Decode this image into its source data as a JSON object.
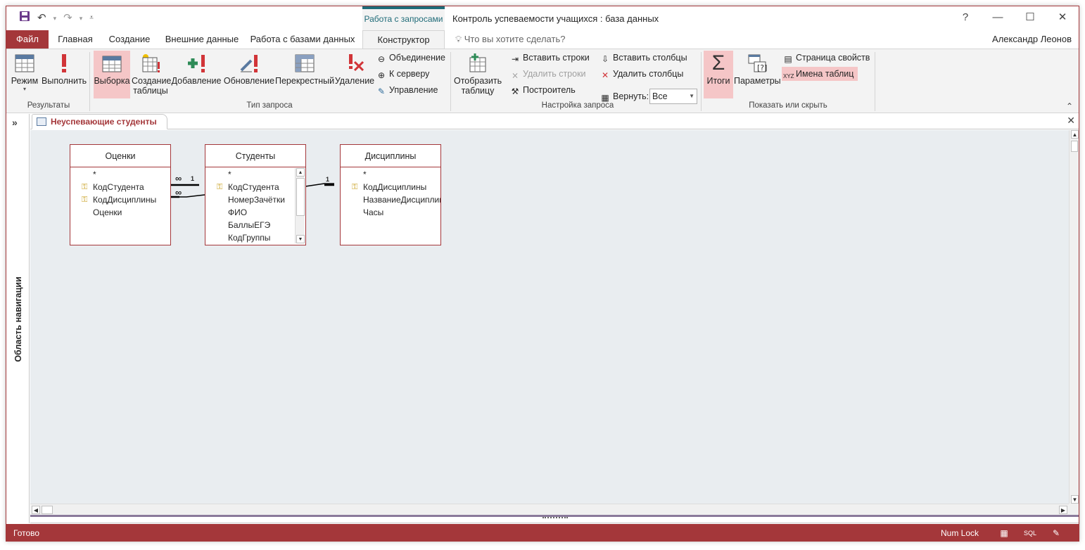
{
  "qat": {
    "save_icon": "save-icon",
    "undo_icon": "undo-icon",
    "redo_icon": "redo-icon",
    "customize_icon": "customize-qat-icon"
  },
  "context_tab": "Работа с запросами",
  "window_title": "Контроль успеваемости учащихся : база данных",
  "window_controls": {
    "help": "?",
    "minimize": "—",
    "maximize": "☐",
    "close": "✕"
  },
  "tabs": [
    "Файл",
    "Главная",
    "Создание",
    "Внешние данные",
    "Работа с базами данных",
    "Конструктор"
  ],
  "tell_me": "Что вы хотите сделать?",
  "user_name": "Александр Леонов",
  "ribbon": {
    "results": {
      "mode": "Режим",
      "run": "Выполнить",
      "label": "Результаты"
    },
    "query_type": {
      "select": "Выборка",
      "make_table_1": "Создание",
      "make_table_2": "таблицы",
      "append": "Добавление",
      "update": "Обновление",
      "crosstab": "Перекрестный",
      "delete": "Удаление",
      "union": "Объединение",
      "pass_through": "К серверу",
      "data_definition": "Управление",
      "label": "Тип запроса"
    },
    "query_setup": {
      "show_table_1": "Отобразить",
      "show_table_2": "таблицу",
      "insert_rows": "Вставить строки",
      "delete_rows": "Удалить строки",
      "builder": "Построитель",
      "insert_columns": "Вставить столбцы",
      "delete_columns": "Удалить столбцы",
      "return_label": "Вернуть:",
      "return_value": "Все",
      "label": "Настройка запроса"
    },
    "show_hide": {
      "totals": "Итоги",
      "parameters": "Параметры",
      "property_sheet": "Страница свойств",
      "table_names": "Имена таблиц",
      "label": "Показать или скрыть"
    }
  },
  "nav_pane": {
    "label": "Область навигации",
    "toggle": "»"
  },
  "document_tab": "Неуспевающие студенты",
  "tables": [
    {
      "name": "Оценки",
      "fields": [
        {
          "name": "*",
          "key": false
        },
        {
          "name": "КодСтудента",
          "key": true
        },
        {
          "name": "КодДисциплины",
          "key": true
        },
        {
          "name": "Оценки",
          "key": false
        }
      ]
    },
    {
      "name": "Студенты",
      "fields": [
        {
          "name": "*",
          "key": false
        },
        {
          "name": "КодСтудента",
          "key": true
        },
        {
          "name": "НомерЗачётки",
          "key": false
        },
        {
          "name": "ФИО",
          "key": false
        },
        {
          "name": "БаллыЕГЭ",
          "key": false
        },
        {
          "name": "КодГруппы",
          "key": false
        }
      ]
    },
    {
      "name": "Дисциплины",
      "fields": [
        {
          "name": "*",
          "key": false
        },
        {
          "name": "КодДисциплины",
          "key": true
        },
        {
          "name": "НазваниеДисциплины",
          "key": false
        },
        {
          "name": "Часы",
          "key": false
        }
      ]
    }
  ],
  "relations": {
    "one": "1",
    "many": "∞"
  },
  "status": {
    "ready": "Готово",
    "numlock": "Num Lock",
    "sql": "SQL"
  },
  "colors": {
    "accent": "#a4373a",
    "context": "#1f6b78",
    "highlight": "#f5c6c7",
    "canvas": "#e9edf0"
  }
}
